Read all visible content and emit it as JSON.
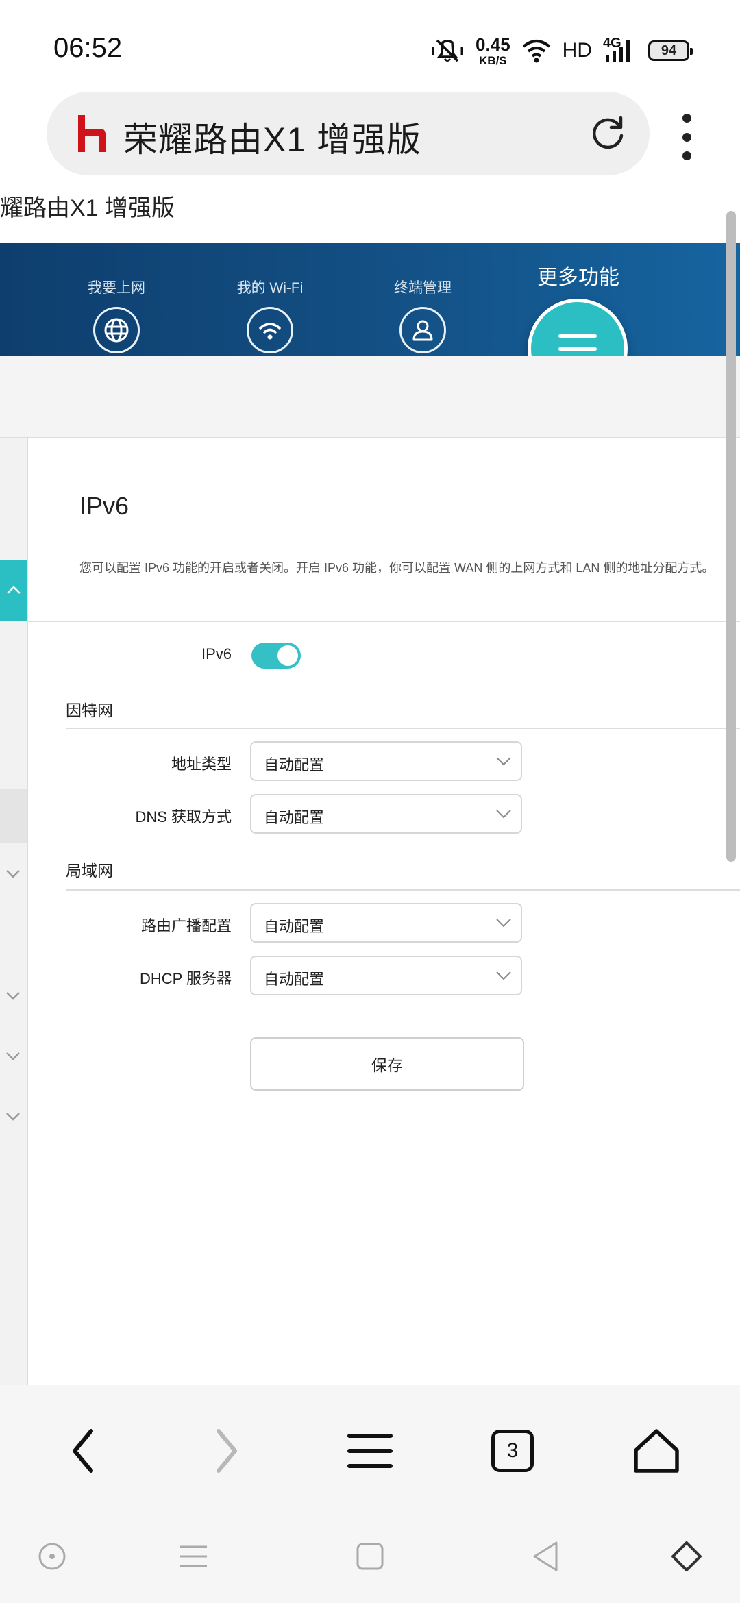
{
  "status_bar": {
    "time": "06:52",
    "speed_value": "0.45",
    "speed_unit": "KB/S",
    "hd": "HD",
    "network": "4G",
    "battery": "94",
    "icons": [
      "mute-icon",
      "wifi-icon",
      "signal-icon",
      "battery-icon"
    ]
  },
  "browser": {
    "address_title": "荣耀路由X1 增强版",
    "page_title": "荣耀路由X1 增强版",
    "tab_count": "3"
  },
  "router_nav": {
    "items": [
      {
        "label": "我要上网",
        "icon": "globe-icon"
      },
      {
        "label": "我的 Wi-Fi",
        "icon": "wifi-icon"
      },
      {
        "label": "终端管理",
        "icon": "user-icon"
      }
    ],
    "more_label": "更多功能"
  },
  "section": {
    "title": "IPv6",
    "description": "您可以配置 IPv6 功能的开启或者关闭。开启 IPv6 功能，你可以配置 WAN 侧的上网方式和 LAN 侧的地址分配方式。"
  },
  "form": {
    "ipv6_label": "IPv6",
    "ipv6_enabled": true,
    "internet_group": "因特网",
    "address_type_label": "地址类型",
    "address_type_value": "自动配置",
    "dns_label": "DNS 获取方式",
    "dns_value": "自动配置",
    "lan_group": "局域网",
    "route_adv_label": "路由广播配置",
    "route_adv_value": "自动配置",
    "dhcp_label": "DHCP 服务器",
    "dhcp_value": "自动配置",
    "save_label": "保存"
  },
  "colors": {
    "accent": "#2bbfc4",
    "header_dark": "#0e3e6e",
    "header_light": "#1664a0"
  }
}
